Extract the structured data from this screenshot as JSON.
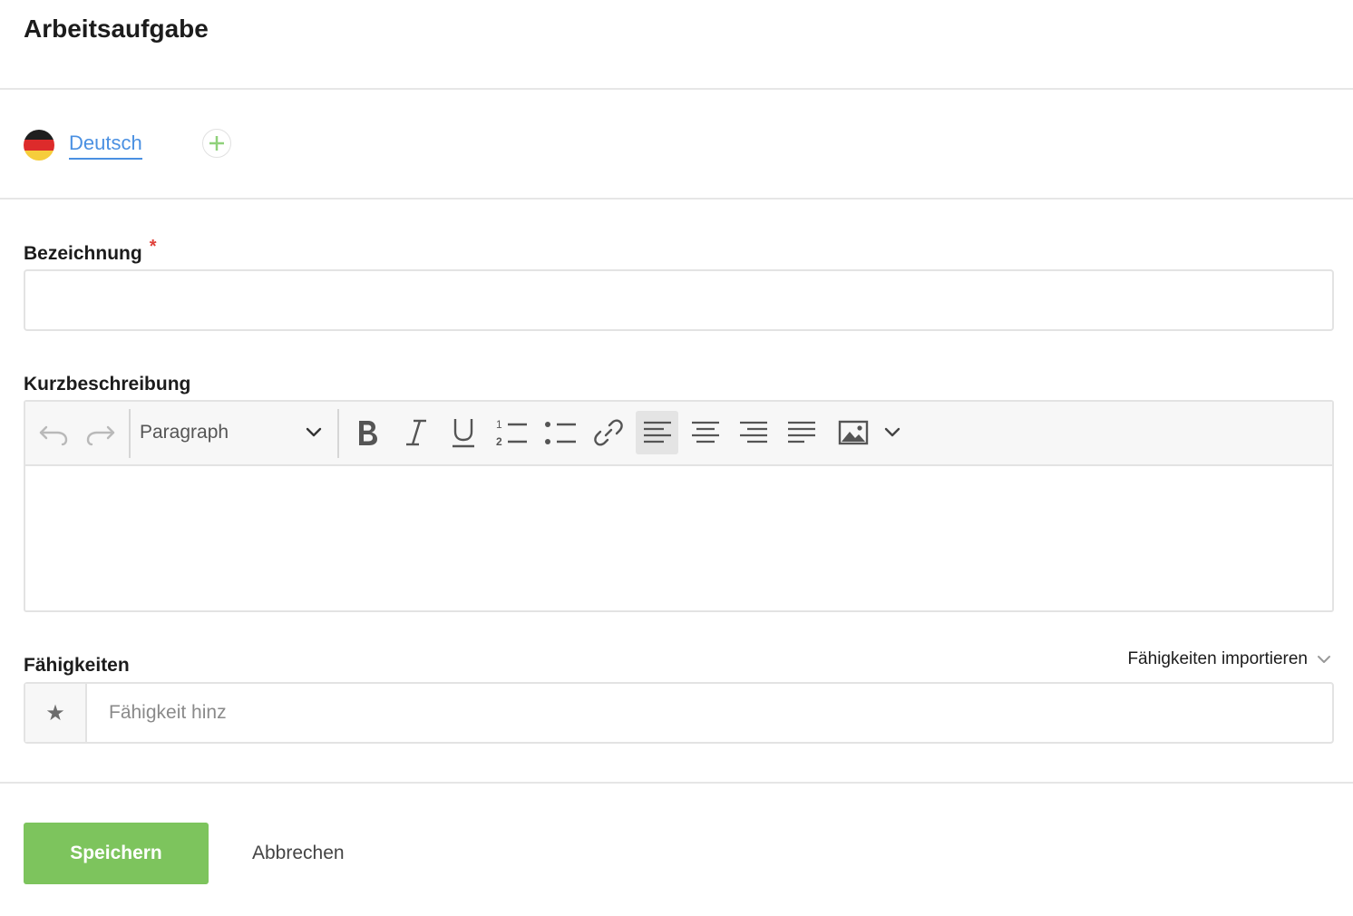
{
  "page": {
    "title": "Arbeitsaufgabe"
  },
  "languages": {
    "items": [
      {
        "label": "Deutsch",
        "active": true
      }
    ],
    "flag_colors": [
      "#1f1f1f",
      "#dd2b2b",
      "#f6cd3c"
    ],
    "add_icon": "plus-icon",
    "add_color": "#7dc45d"
  },
  "form": {
    "name_label": "Bezeichnung",
    "required_mark": "*",
    "name_value": "",
    "description_label": "Kurzbeschreibung",
    "skills_label": "Fähigkeiten",
    "skills_import": "Fähigkeiten importieren",
    "skills_placeholder": "Fähigkeit hinz",
    "skills_icon": "star-icon"
  },
  "editor": {
    "block_format": "Paragraph",
    "toolbar": [
      "undo-icon",
      "redo-icon",
      "bold-icon",
      "italic-icon",
      "underline-icon",
      "ordered-list-icon",
      "bullet-list-icon",
      "link-icon",
      "align-left-icon",
      "align-center-icon",
      "align-right-icon",
      "align-justify-icon",
      "image-icon",
      "chevron-down-icon"
    ],
    "active_tool": "align-left-icon",
    "content": ""
  },
  "actions": {
    "save_label": "Speichern",
    "cancel_label": "Abbrechen",
    "save_color": "#7dc45d"
  }
}
